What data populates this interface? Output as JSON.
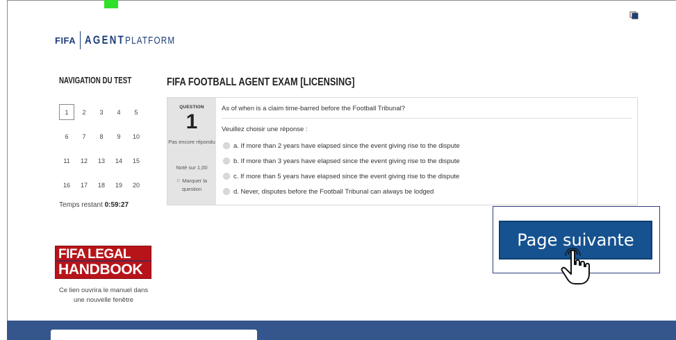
{
  "header": {
    "logo_fifa": "FIFA",
    "logo_agent": "AGENT",
    "logo_platform": "PLATFORM"
  },
  "navigation": {
    "title": "NAVIGATION DU TEST",
    "questions": [
      "1",
      "2",
      "3",
      "4",
      "5",
      "6",
      "7",
      "8",
      "9",
      "10",
      "11",
      "12",
      "13",
      "14",
      "15",
      "16",
      "17",
      "18",
      "19",
      "20"
    ],
    "current_question": "1",
    "time_label": "Temps restant",
    "time_value": "0:59:27"
  },
  "handbook": {
    "line1_fifa": "FIFA",
    "line1_legal": "LEGAL",
    "line2": "HANDBOOK",
    "caption": "Ce lien ouvrira le manuel dans une nouvelle fenêtre"
  },
  "exam": {
    "title": "FIFA FOOTBALL AGENT EXAM [LICENSING]",
    "question_label": "QUESTION",
    "question_number": "1",
    "status": "Pas encore répondu",
    "score": "Noté sur 1,00",
    "flag_label": "Marquer la question",
    "question_text": "As of when is a claim time-barred before the Football Tribunal?",
    "prompt": "Veuillez choisir une réponse :",
    "answers": [
      "a. If more than 2 years have elapsed since the event giving rise to the dispute",
      "b. If more than 3 years have elapsed since the event giving rise to the dispute",
      "c. If more than 5 years have elapsed since the event giving rise to the dispute",
      "d. Never, disputes before the Football Tribunal can always be lodged"
    ]
  },
  "actions": {
    "next_label": "Page suivante"
  },
  "colors": {
    "brand_blue": "#1b3c7a",
    "button_blue": "#16528f",
    "footer_blue": "#35568c",
    "handbook_red": "#b7141a",
    "marker_green": "#2fe02a"
  },
  "icons": {
    "corner": "window-icon",
    "flag": "flag-icon",
    "cursor": "hand-pointer-icon"
  }
}
